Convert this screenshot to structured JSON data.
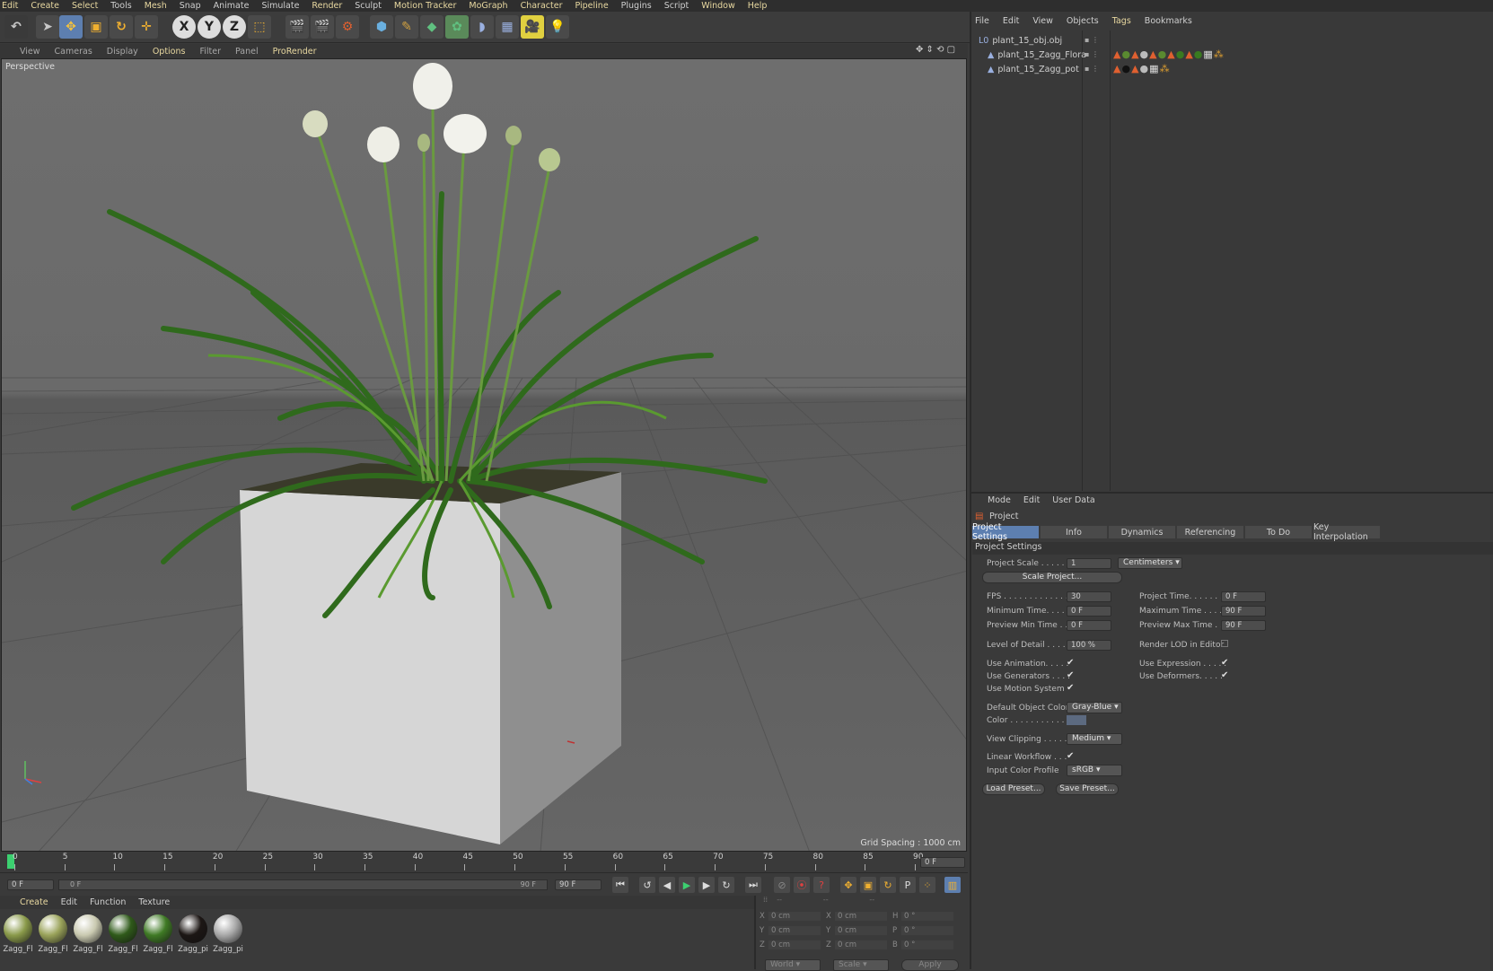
{
  "menubar": [
    "Edit",
    "Create",
    "Select",
    "Tools",
    "Mesh",
    "Snap",
    "Animate",
    "Simulate",
    "Render",
    "Sculpt",
    "Motion Tracker",
    "MoGraph",
    "Character",
    "Pipeline",
    "Plugins",
    "Script",
    "Window",
    "Help"
  ],
  "toolbar": {
    "x": "X",
    "y": "Y",
    "z": "Z"
  },
  "viewport_menu": [
    "View",
    "Cameras",
    "Display",
    "Options",
    "Filter",
    "Panel",
    "ProRender"
  ],
  "viewport": {
    "label": "Perspective",
    "grid_spacing": "Grid Spacing : 1000 cm"
  },
  "object_manager": {
    "menu": [
      "File",
      "Edit",
      "View",
      "Objects",
      "Tags",
      "Bookmarks"
    ],
    "objects": [
      {
        "name": "plant_15_obj.obj"
      },
      {
        "name": "plant_15_Zagg_Flora"
      },
      {
        "name": "plant_15_Zagg_pot"
      }
    ]
  },
  "attributes": {
    "menu": [
      "Mode",
      "Edit",
      "User Data"
    ],
    "title": "Project",
    "tabs": [
      "Project Settings",
      "Info",
      "Dynamics",
      "Referencing",
      "To Do",
      "Key Interpolation"
    ],
    "section": "Project Settings",
    "project_scale_label": "Project Scale . . . . . .",
    "project_scale_value": "1",
    "project_scale_unit": "Centimeters",
    "scale_project_btn": "Scale Project...",
    "fps_label": "FPS . . . . . . . . . . . . . . .",
    "fps_value": "30",
    "min_time_label": "Minimum Time. . . . . .",
    "min_time_value": "0 F",
    "prev_min_label": "Preview Min Time . . .",
    "prev_min_value": "0 F",
    "proj_time_label": "Project Time. . . . . . . .",
    "proj_time_value": "0 F",
    "max_time_label": "Maximum Time . . . . . .",
    "max_time_value": "90 F",
    "prev_max_label": "Preview Max Time . . .",
    "prev_max_value": "90 F",
    "lod_label": "Level of Detail . . . . .",
    "lod_value": "100 %",
    "render_lod_label": "Render LOD in Editor",
    "use_anim_label": "Use Animation. . . . .",
    "use_gen_label": "Use Generators . . . .",
    "use_motion_label": "Use Motion System",
    "use_expr_label": "Use Expression . . . . .",
    "use_deform_label": "Use Deformers. . . . .",
    "def_color_label": "Default Object Color",
    "def_color_value": "Gray-Blue",
    "color_label": "Color . . . . . . . . . . .",
    "view_clip_label": "View Clipping . . . . .",
    "view_clip_value": "Medium",
    "linear_label": "Linear Workflow . . .",
    "icp_label": "Input Color Profile",
    "icp_value": "sRGB",
    "load_preset": "Load Preset...",
    "save_preset": "Save Preset..."
  },
  "timeline": {
    "ticks": [
      "0",
      "5",
      "10",
      "15",
      "20",
      "25",
      "30",
      "35",
      "40",
      "45",
      "50",
      "55",
      "60",
      "65",
      "70",
      "75",
      "80",
      "85",
      "90"
    ],
    "current": "0 F",
    "start": "0 F",
    "range_start": "0 F",
    "range_end": "90 F",
    "end": "90 F"
  },
  "material_manager": {
    "menu": [
      "Create",
      "Edit",
      "Function",
      "Texture"
    ],
    "materials": [
      {
        "name": "Zagg_Fl",
        "color": "#8a9a4a"
      },
      {
        "name": "Zagg_Fl",
        "color": "#9aa35a"
      },
      {
        "name": "Zagg_Fl",
        "color": "#c9c9b0"
      },
      {
        "name": "Zagg_Fl",
        "color": "#2f5a1a"
      },
      {
        "name": "Zagg_Fl",
        "color": "#3f7a25"
      },
      {
        "name": "Zagg_pi",
        "color": "#1c1614"
      },
      {
        "name": "Zagg_pi",
        "color": "#a8a8a8"
      }
    ]
  },
  "coordinates": {
    "rows": [
      {
        "a": "X",
        "v1": "0 cm",
        "b": "X",
        "v2": "0 cm",
        "c": "H",
        "v3": "0 °"
      },
      {
        "a": "Y",
        "v1": "0 cm",
        "b": "Y",
        "v2": "0 cm",
        "c": "P",
        "v3": "0 °"
      },
      {
        "a": "Z",
        "v1": "0 cm",
        "b": "Z",
        "v2": "0 cm",
        "c": "B",
        "v3": "0 °"
      }
    ],
    "world": "World",
    "scale": "Scale",
    "apply": "Apply"
  }
}
